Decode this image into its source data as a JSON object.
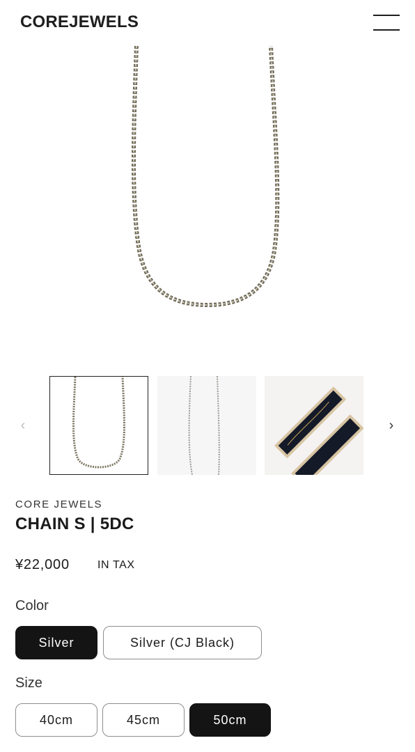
{
  "header": {
    "logo": "COREJEWELS",
    "menu_icon": "hamburger-menu-icon"
  },
  "gallery": {
    "prev_icon": "chevron-left-icon",
    "next_icon": "chevron-right-icon",
    "prev_glyph": "‹",
    "next_glyph": "›",
    "thumbnails": [
      {
        "name": "chain-front",
        "selected": true
      },
      {
        "name": "chain-side",
        "selected": false
      },
      {
        "name": "jewelry-box",
        "selected": false
      }
    ]
  },
  "product": {
    "brand": "CORE JEWELS",
    "title": "CHAIN S | 5DC",
    "price": "¥22,000",
    "tax_label": "IN TAX"
  },
  "options": {
    "color_label": "Color",
    "colors": [
      {
        "label": "Silver",
        "selected": true
      },
      {
        "label": "Silver (CJ Black)",
        "selected": false
      }
    ],
    "size_label": "Size",
    "sizes": [
      {
        "label": "40cm",
        "selected": false
      },
      {
        "label": "45cm",
        "selected": false
      },
      {
        "label": "50cm",
        "selected": true
      }
    ]
  },
  "colors": {
    "chain": "#7c7663",
    "selected_bg": "#141414",
    "border": "#8d8d8d",
    "box_tan": "#d8c4a3",
    "box_inside": "#141a28"
  }
}
